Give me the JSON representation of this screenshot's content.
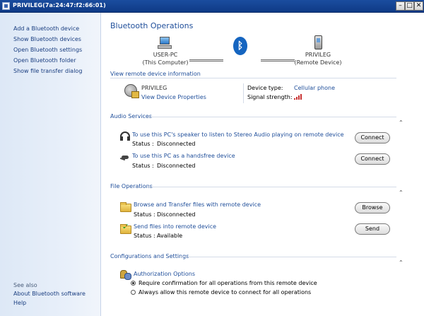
{
  "window": {
    "title": "PRIVILEG(7a:24:47:f2:66:01)",
    "minimize": "–",
    "maximize": "□",
    "close": "✕"
  },
  "sidebar": {
    "tasks": [
      "Add a Bluetooth device",
      "Show Bluetooth devices",
      "Open Bluetooth settings",
      "Open Bluetooth folder",
      "Show file transfer dialog"
    ],
    "see_also_label": "See also",
    "see_also": [
      "About Bluetooth software",
      "Help"
    ]
  },
  "header": {
    "title": "Bluetooth Operations"
  },
  "devices": {
    "local_name": "USER-PC",
    "local_sub": "(This Computer)",
    "remote_name": "PRIVILEG",
    "remote_sub": "(Remote Device)",
    "bluetooth_glyph": "ᛒ"
  },
  "remote_info": {
    "section_title": "View remote device information",
    "device_name": "PRIVILEG",
    "properties_link": "View Device Properties",
    "device_type_label": "Device type:",
    "device_type_value": "Cellular phone",
    "signal_label": "Signal strength:"
  },
  "audio": {
    "section_title": "Audio Services",
    "collapse_glyph": "⌃",
    "services": [
      {
        "link": "To use this PC's speaker to listen to Stereo Audio playing on remote device",
        "status_label": "Status :",
        "status_value": "Disconnected",
        "button": "Connect"
      },
      {
        "link": "To use this PC as a handsfree device",
        "status_label": "Status :",
        "status_value": "Disconnected",
        "button": "Connect"
      }
    ]
  },
  "files": {
    "section_title": "File Operations",
    "collapse_glyph": "⌃",
    "ops": [
      {
        "link": "Browse and Transfer files with remote device",
        "status_label": "Status :",
        "status_value": "Disconnected",
        "button": "Browse"
      },
      {
        "link": "Send files into remote device",
        "status_label": "Status :",
        "status_value": "Available",
        "button": "Send"
      }
    ]
  },
  "config": {
    "section_title": "Configurations and Settings",
    "collapse_glyph": "⌃",
    "auth_link": "Authorization Options",
    "option_confirm": "Require confirmation for all operations from this remote device",
    "option_allow": "Always allow this remote device to connect for all operations",
    "selected": "confirm"
  }
}
